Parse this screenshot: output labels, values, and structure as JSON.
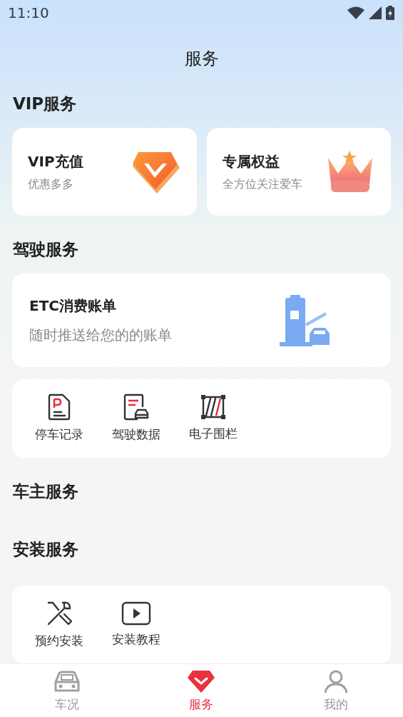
{
  "status_bar": {
    "time": "11:10"
  },
  "title": "服务",
  "sections": [
    {
      "kind": "promo",
      "title": "VIP服务",
      "cards": [
        {
          "title": "VIP充值",
          "subtitle": "优惠多多"
        },
        {
          "title": "专属权益",
          "subtitle": "全方位关注爱车"
        }
      ]
    },
    {
      "kind": "drive",
      "title": "驾驶服务",
      "banner": {
        "title": "ETC消费账单",
        "subtitle": "随时推送给您的的账单"
      },
      "items": [
        "停车记录",
        "驾驶数据",
        "电子围栏"
      ]
    },
    {
      "kind": "empty",
      "title": "车主服务"
    },
    {
      "kind": "grid",
      "title": "安装服务",
      "items": [
        "预约安装",
        "安装教程"
      ]
    }
  ],
  "tabs": [
    {
      "label": "车况",
      "selected": false
    },
    {
      "label": "服务",
      "selected": true
    },
    {
      "label": "我的",
      "selected": false
    }
  ]
}
